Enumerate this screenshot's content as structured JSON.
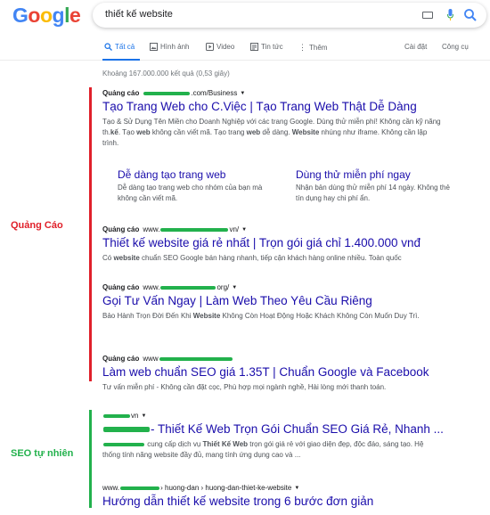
{
  "logo": {
    "letters": [
      "G",
      "o",
      "o",
      "g",
      "l",
      "e"
    ]
  },
  "search": {
    "query": "thiết kế website"
  },
  "tabs": [
    {
      "label": "Tất cả",
      "icon": "search-icon"
    },
    {
      "label": "Hình ảnh",
      "icon": "image-icon"
    },
    {
      "label": "Video",
      "icon": "video-icon"
    },
    {
      "label": "Tin tức",
      "icon": "news-icon"
    },
    {
      "label": "Thêm",
      "icon": "more-icon"
    }
  ],
  "tools": {
    "settings": "Cài đặt",
    "tools": "Công cụ"
  },
  "stats": "Khoảng 167.000.000 kết quả (0,53 giây)",
  "annotations": {
    "ads": "Quảng Cáo",
    "seo": "SEO tự nhiên"
  },
  "ads": [
    {
      "badge": "Quảng cáo",
      "url_suffix": ".com/Business",
      "title": "Tạo Trang Web cho C.Việc | Tạo Trang Web Thật Dễ Dàng",
      "snippet_html": "Tạo & Sử Dụng Tên Miền cho Doanh Nghiệp với các trang Google. Dùng thử miễn phí! Không cần kỹ năng th.<b>kế</b>. Tạo <b>web</b> không cần viết mã. Tạo trang <b>web</b> dễ dàng. <b>Website</b> nhúng như iframe. Không cần lập trình."
    },
    {
      "badge": "Quảng cáo",
      "url_prefix": "www.",
      "url_suffix": "vn/",
      "title": "Thiết kế website giá rẻ nhất | Trọn gói giá chỉ 1.400.000 vnđ",
      "snippet_html": "Có <b>website</b> chuẩn SEO Google bán hàng nhanh, tiếp cận khách hàng online nhiều. Toàn quốc"
    },
    {
      "badge": "Quảng cáo",
      "url_prefix": "www.",
      "url_suffix": "org/",
      "title": "Gọi Tư Vấn Ngay | Làm Web Theo Yêu Cầu Riêng",
      "snippet_html": "Bảo Hành Trọn Đời Đến Khi <b>Website</b> Không Còn Hoạt Động Hoặc Khách Không Còn Muốn Duy Trì."
    },
    {
      "badge": "Quảng cáo",
      "url_prefix": "www",
      "url_suffix": "",
      "title": "Làm web chuẩn SEO giá 1.35T | Chuẩn Google và Facebook",
      "snippet_html": "Tư vấn miễn phí - Không cần đặt cọc, Phù hợp mọi ngành nghề, Hài lòng mới thanh toán."
    }
  ],
  "sitelinks": [
    {
      "title": "Dễ dàng tạo trang web",
      "desc": "Dễ dàng tạo trang web cho nhóm của bạn mà không cần viết mã."
    },
    {
      "title": "Dùng thử miễn phí ngay",
      "desc": "Nhận bản dùng thử miễn phí 14 ngày. Không thẻ tín dụng hay chi phí ẩn."
    }
  ],
  "organic": [
    {
      "url_suffix": "vn",
      "title": "- Thiết Kế Web Trọn Gói Chuẩn SEO Giá Rẻ, Nhanh ...",
      "snippet_html": "cung cấp dịch vụ <b>Thiết Kế Web</b> trọn gói giá rẻ với giao diện đẹp, độc đáo, sáng tạo. Hệ thống tính năng website đầy đủ, mang tính ứng dụng cao và ..."
    },
    {
      "url_prefix": "www.",
      "url_suffix": "› huong-dan › huong-dan-thiet-ke-website",
      "title": "Hướng dẫn thiết kế website trong 6 bước đơn giản"
    }
  ]
}
